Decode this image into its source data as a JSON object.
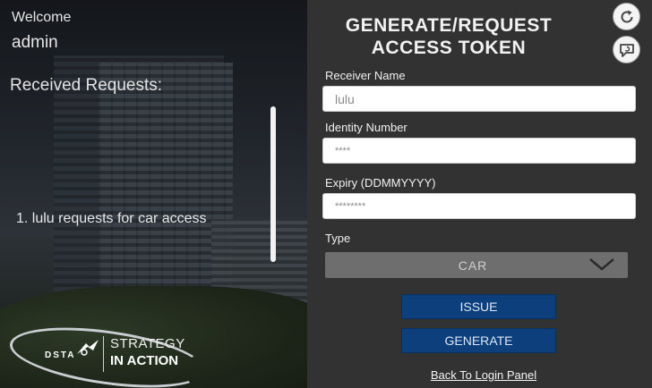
{
  "sidebar": {
    "welcome_label": "Welcome",
    "username": "admin",
    "received_title": "Received Requests:",
    "requests": [
      {
        "text": "1. lulu requests for car access"
      }
    ],
    "logo": {
      "org_short": "DSTA",
      "tagline_line1": "STRATEGY",
      "tagline_line2": "IN ACTION"
    }
  },
  "form": {
    "title_line1": "GENERATE/REQUEST",
    "title_line2": "ACCESS TOKEN",
    "receiver_name": {
      "label": "Receiver Name",
      "value": "lulu"
    },
    "identity_number": {
      "label": "Identity Number",
      "value": "****"
    },
    "expiry": {
      "label": "Expiry (DDMMYYYY)",
      "value": "********"
    },
    "type": {
      "label": "Type",
      "selected": "CAR"
    },
    "issue_label": "ISSUE",
    "generate_label": "GENERATE",
    "back_link": "Back To Login Panel"
  },
  "icons": {
    "refresh": "refresh-icon",
    "chat": "chat-icon",
    "chevron": "chevron-down-icon"
  },
  "colors": {
    "panel_bg": "#323232",
    "button_blue": "#0d3f7d",
    "select_bg": "#6e6e6e"
  }
}
